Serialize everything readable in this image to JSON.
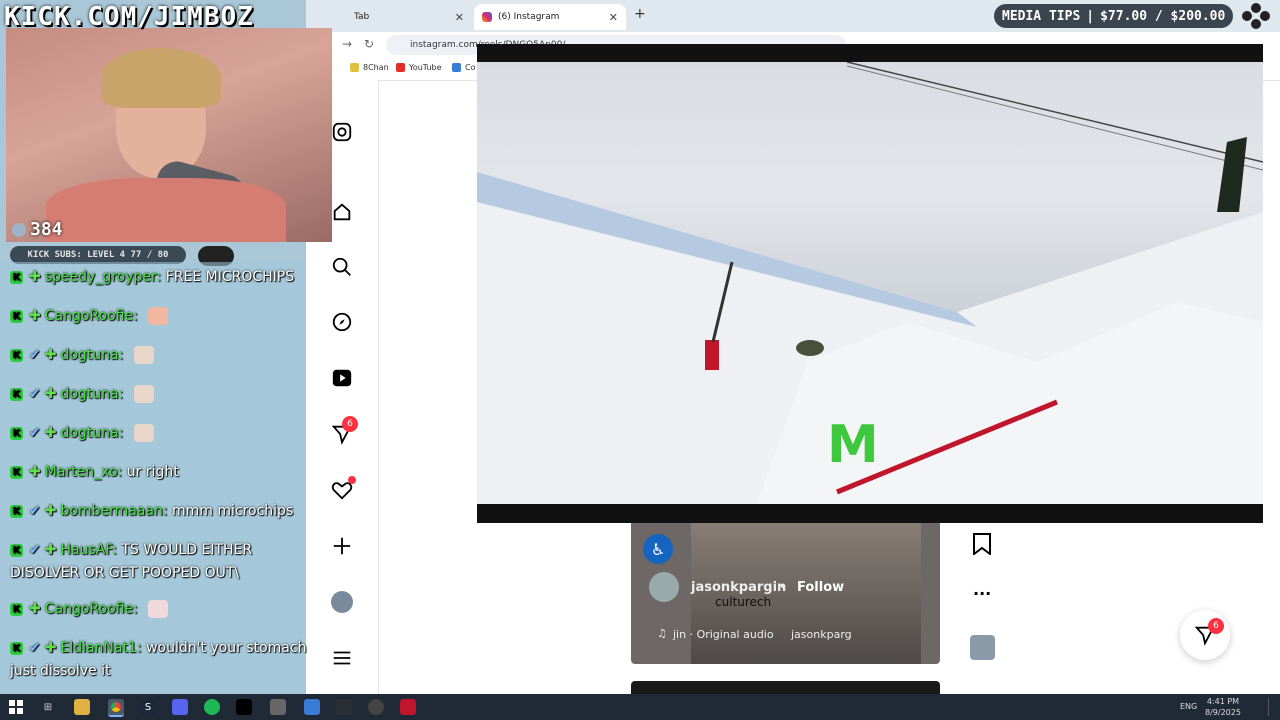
{
  "stream": {
    "title": "KICK.COM/JIMBOZ",
    "viewers": "384",
    "subs_bar": "KICK SUBS: LEVEL 4 77 / 80",
    "media_tips_label": "MEDIA TIPS",
    "media_tips_amount": "$77.00 / $200.00"
  },
  "browser": {
    "tabs": [
      {
        "label": "Tab"
      },
      {
        "label": "(6) Instagram"
      }
    ],
    "url": "instagram.com/reels/DNGQ5Ap00/",
    "bookmarks": [
      {
        "label": "8Chan"
      },
      {
        "label": "YouTube"
      },
      {
        "label": "Co"
      }
    ]
  },
  "instagram": {
    "sidebar_badges": {
      "messages": "6"
    },
    "reel": {
      "username": "jasonkpargin",
      "follow_label": "Follow",
      "subtext": "culturech",
      "audio": "jin · Original audio",
      "audio_user": "jasonkparg"
    },
    "floating_badge": "6"
  },
  "chat": [
    {
      "user": "speedy_groyper:",
      "message": "FREE MICROCHIPS",
      "verified": false
    },
    {
      "user": "CangoRoofie:",
      "message": "",
      "verified": false,
      "emote": true
    },
    {
      "user": "dogtuna:",
      "message": "",
      "verified": true,
      "emote": true
    },
    {
      "user": "dogtuna:",
      "message": "",
      "verified": true,
      "emote": true
    },
    {
      "user": "dogtuna:",
      "message": "",
      "verified": true,
      "emote": true
    },
    {
      "user": "Marten_xo:",
      "message": "ur right",
      "verified": false
    },
    {
      "user": "bombermaaan:",
      "message": "mmm microchips",
      "verified": true
    },
    {
      "user": "HausAF:",
      "message": "TS WOULD EITHER DISOLVER OR GET POOPED OUT\\",
      "verified": true
    },
    {
      "user": "CangoRoofie:",
      "message": "",
      "verified": false,
      "emote": true
    },
    {
      "user": "EldianNat1:",
      "message": "wouldn't your stomach just dissolve it",
      "verified": true
    }
  ],
  "taskbar": {
    "lang": "ENG",
    "time": "4:41 PM",
    "date": "8/9/2025"
  },
  "colors": {
    "kick_green": "#53fc18",
    "ig_badge": "#ff3040"
  }
}
